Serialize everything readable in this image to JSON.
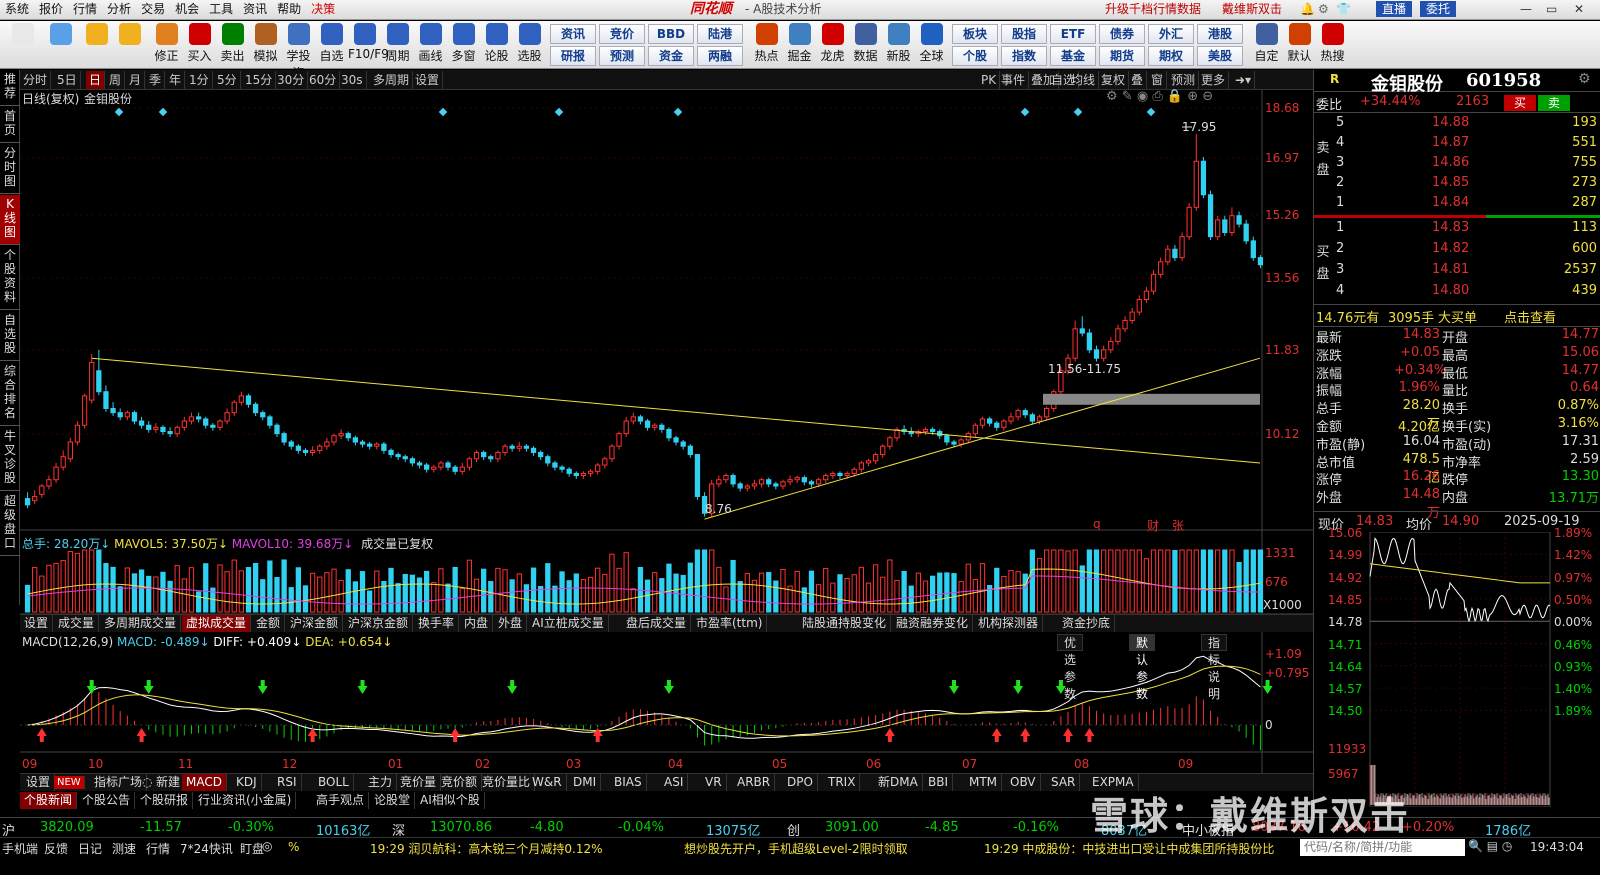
{
  "menu": {
    "items": [
      "系统",
      "报价",
      "行情",
      "分析",
      "交易",
      "机会",
      "工具",
      "资讯",
      "帮助",
      "决策"
    ],
    "logo": "同花顺",
    "title": "- A股技术分析",
    "promo": "升级千档行情数据",
    "user": "戴维斯双击",
    "live": "直播",
    "entrust": "委托"
  },
  "toolbar": {
    "icons": [
      {
        "label": "",
        "icon": "grid-icon",
        "color": "#e8e8e8"
      },
      {
        "label": "",
        "icon": "robot-icon",
        "color": "#5aa0e8"
      },
      {
        "label": "",
        "icon": "back-arrow-icon",
        "color": "#f0b020"
      },
      {
        "label": "",
        "icon": "updown-arrow-icon",
        "color": "#f0b020"
      },
      {
        "label": "修正",
        "icon": "fix-icon",
        "color": "#e08020"
      },
      {
        "label": "买入",
        "icon": "buy-icon",
        "color": "#d00000"
      },
      {
        "label": "卖出",
        "icon": "sell-icon",
        "color": "#008000"
      },
      {
        "label": "模拟",
        "icon": "hammer-icon",
        "color": "#b06020"
      },
      {
        "label": "学投资",
        "icon": "grad-cap-icon",
        "color": "#4070c0"
      },
      {
        "label": "自选",
        "icon": "star-icon",
        "color": "#3060c0"
      },
      {
        "label": "F10/F9",
        "icon": "f10-icon",
        "color": "#3060c0"
      },
      {
        "label": "周期",
        "icon": "clock-icon",
        "color": "#3060c0"
      },
      {
        "label": "画线",
        "icon": "pen-icon",
        "color": "#3060c0"
      },
      {
        "label": "多窗",
        "icon": "windows-icon",
        "color": "#3060c0"
      },
      {
        "label": "论股",
        "icon": "talk-icon",
        "color": "#3060c0"
      },
      {
        "label": "选股",
        "icon": "magnify-icon",
        "color": "#3060c0"
      }
    ],
    "btns1": [
      "资讯",
      "竞价",
      "BBD",
      "陆港"
    ],
    "btns2": [
      "研报",
      "预测",
      "资金",
      "两融"
    ],
    "icons2": [
      {
        "label": "热点",
        "icon": "fire-icon",
        "color": "#d04000"
      },
      {
        "label": "掘金",
        "icon": "gold-icon",
        "color": "#4080c0"
      },
      {
        "label": "龙虎",
        "icon": "dragon-icon",
        "color": "#d00000"
      },
      {
        "label": "数据",
        "icon": "pe-icon",
        "color": "#4060a0"
      },
      {
        "label": "新股",
        "icon": "ipo-icon",
        "color": "#4080c0"
      },
      {
        "label": "全球",
        "icon": "globe-icon",
        "color": "#2060c0"
      }
    ],
    "btns3": [
      "板块",
      "股指",
      "ETF",
      "债券",
      "外汇",
      "港股"
    ],
    "btns4": [
      "个股",
      "指数",
      "基金",
      "期货",
      "期权",
      "美股"
    ],
    "icons3": [
      {
        "label": "自定",
        "icon": "custom-icon",
        "color": "#4060a0"
      },
      {
        "label": "默认",
        "icon": "home-icon",
        "color": "#d04000"
      },
      {
        "label": "热搜",
        "icon": "hot-search-icon",
        "color": "#d00000"
      }
    ]
  },
  "leftnav": [
    "推荐",
    "首页",
    "分时图",
    "K线图",
    "个股资料",
    "自选股",
    "综合排名",
    "牛叉诊股",
    "超级盘口"
  ],
  "periods": [
    "分时",
    "5日",
    "日",
    "周",
    "月",
    "季",
    "年",
    "1分",
    "5分",
    "15分",
    "30分",
    "60分",
    "30s",
    "多周期",
    "设置"
  ],
  "period_right": [
    "PK",
    "事件",
    "叠加",
    "自选",
    "均线",
    "复权",
    "叠",
    "窗",
    "预测",
    "更多"
  ],
  "chart_head": {
    "mode": "日线(复权)",
    "name": "金钼股份"
  },
  "price_axis": [
    "18.68",
    "16.97",
    "15.26",
    "13.56",
    "11.83",
    "10.12"
  ],
  "annotations": {
    "high": "17.95",
    "low": "8.76",
    "gap": "11.56-11.75",
    "q": "q",
    "cai": "财",
    "zhang": "张"
  },
  "vol_head": {
    "total_label": "总手: ",
    "total": "28.20万",
    "mavol5_label": "MAVOL5: ",
    "mavol5": "37.50万",
    "mavol10_label": "MAVOL10: ",
    "mavol10": "39.68万",
    "note": "成交量已复权"
  },
  "vol_axis": [
    "1331",
    "676",
    "X1000"
  ],
  "ind_tabs": [
    "设置",
    "成交量",
    "多周期成交量",
    "虚拟成交量",
    "金额",
    "沪深金额",
    "沪深京金额",
    "换手率",
    "内盘",
    "外盘",
    "AI立桩成交量",
    "盘后成交量",
    "市盈率(ttm)",
    "陆股通持股变化",
    "融资融券变化",
    "机构探测器",
    "资金抄底"
  ],
  "macd_head": {
    "name": "MACD(12,26,9)",
    "macd_label": "MACD: ",
    "macd": "-0.489",
    "diff_label": "DIFF: ",
    "diff": "+0.409",
    "dea_label": "DEA: ",
    "dea": "+0.654"
  },
  "macd_buttons": [
    "优选参数",
    "默认参数",
    "指标说明"
  ],
  "macd_axis": [
    "+1.09",
    "+0.795",
    "0"
  ],
  "months": [
    "09",
    "10",
    "11",
    "12",
    "01",
    "02",
    "03",
    "04",
    "05",
    "06",
    "07",
    "08",
    "09"
  ],
  "bottom_tabs": [
    "设置",
    "NEW",
    "指标广场",
    "新建",
    "MACD",
    "KDJ",
    "RSI",
    "BOLL",
    "主力",
    "竞价量",
    "竞价额",
    "竞价量比",
    "W&R",
    "DMI",
    "BIAS",
    "ASI",
    "VR",
    "ARBR",
    "DPO",
    "TRIX",
    "新DMA",
    "BBI",
    "MTM",
    "OBV",
    "SAR",
    "EXPMA"
  ],
  "news_tabs": [
    "个股新闻",
    "个股公告",
    "个股研报",
    "行业资讯(小金属)",
    "高手观点",
    "论股堂",
    "AI相似个股"
  ],
  "stock": {
    "r": "R",
    "name": "金钼股份",
    "code": "601958",
    "weibi_label": "委比",
    "weibi": "+34.44%",
    "weicha": "2163",
    "buy": "买",
    "sell": "卖"
  },
  "asks": [
    {
      "lv": "5",
      "p": "14.88",
      "v": "193"
    },
    {
      "lv": "4",
      "p": "14.87",
      "v": "551"
    },
    {
      "lv": "3",
      "p": "14.86",
      "v": "755"
    },
    {
      "lv": "2",
      "p": "14.85",
      "v": "273"
    },
    {
      "lv": "1",
      "p": "14.84",
      "v": "287"
    }
  ],
  "bids": [
    {
      "lv": "1",
      "p": "14.83",
      "v": "113"
    },
    {
      "lv": "2",
      "p": "14.82",
      "v": "600"
    },
    {
      "lv": "3",
      "p": "14.81",
      "v": "2537"
    },
    {
      "lv": "4",
      "p": "14.80",
      "v": "439"
    }
  ],
  "side_labels": {
    "sell": "卖盘",
    "buy": "买盘"
  },
  "bigorder": {
    "price": "14.76元有",
    "hand": "3095手",
    "label": "大买单",
    "link": "点击查看"
  },
  "quote": [
    [
      "最新",
      "14.83",
      "开盘",
      "14.77"
    ],
    [
      "涨跌",
      "+0.05",
      "最高",
      "15.06"
    ],
    [
      "涨幅",
      "+0.34%",
      "最低",
      "14.77"
    ],
    [
      "振幅",
      "1.96%",
      "量比",
      "0.64"
    ],
    [
      "总手",
      "28.20万",
      "换手",
      "0.87%"
    ],
    [
      "金额",
      "4.20亿",
      "换手(实)",
      "3.16%"
    ],
    [
      "市盈(静)",
      "16.04",
      "市盈(动)",
      "17.31"
    ],
    [
      "总市值",
      "478.5亿",
      "市净率",
      "2.59"
    ],
    [
      "涨停",
      "16.26",
      "跌停",
      "13.30"
    ],
    [
      "外盘",
      "14.48万",
      "内盘",
      "13.71万"
    ]
  ],
  "intraday": {
    "now_label": "现价",
    "now": "14.83",
    "avg_label": "均价",
    "avg": "14.90",
    "date": "2025-09-19",
    "left_axis": [
      "15.06",
      "14.99",
      "14.92",
      "14.85",
      "14.78",
      "14.71",
      "14.64",
      "14.57",
      "14.50"
    ],
    "right_axis": [
      "1.89%",
      "1.42%",
      "0.97%",
      "0.50%",
      "0.00%",
      "0.46%",
      "0.93%",
      "1.40%",
      "1.89%"
    ],
    "vol_axis": [
      "11933",
      "5967"
    ]
  },
  "status": [
    {
      "name": "沪",
      "val": "3820.09",
      "chg": "-11.57",
      "pct": "-0.30%",
      "amt": "10163亿"
    },
    {
      "name": "深",
      "val": "13070.86",
      "chg": "-4.80",
      "pct": "-0.04%",
      "amt": "13075亿"
    },
    {
      "name": "创",
      "val": "3091.00",
      "chg": "-4.85",
      "pct": "-0.16%",
      "amt": "8037亿"
    }
  ],
  "status_extra": {
    "name": "中小板指",
    "val": "8037.16",
    "chg": "+16.42",
    "pct": "+0.20%",
    "amt": "1786亿"
  },
  "ticker": {
    "items": [
      "手机端",
      "反馈",
      "日记",
      "测速",
      "行情",
      "7*24快讯",
      "盯盘"
    ],
    "pct": "%",
    "news1": "19:29 润贝航科：高木锐三个月减持0.12%",
    "news2": "想炒股先开户，手机超级Level-2限时领取",
    "news3": "19:29 中成股份：中技进出口受让中成集团所持股份比",
    "search": "代码/名称/简拼/功能",
    "time": "19:43:04"
  },
  "watermark": "雪球：戴维斯双击",
  "chart_data": {
    "type": "candlestick",
    "ylim": [
      8.5,
      19.0
    ],
    "months": [
      "09",
      "10",
      "11",
      "12",
      "01",
      "02",
      "03",
      "04",
      "05",
      "06",
      "07",
      "08",
      "09"
    ],
    "candles": [
      [
        9.25,
        9.1,
        9.4
      ],
      [
        9.2,
        9.3,
        9.45
      ],
      [
        9.35,
        9.55,
        9.6
      ],
      [
        9.55,
        9.7,
        9.8
      ],
      [
        9.7,
        10.0,
        10.1
      ],
      [
        10.0,
        10.25,
        10.4
      ],
      [
        10.2,
        10.6,
        10.7
      ],
      [
        10.6,
        11.0,
        11.1
      ],
      [
        11.0,
        11.7,
        11.75
      ],
      [
        11.6,
        12.5,
        12.7
      ],
      [
        12.3,
        11.8,
        12.8
      ],
      [
        11.8,
        11.4,
        11.95
      ],
      [
        11.4,
        11.3,
        11.55
      ],
      [
        11.3,
        11.2,
        11.4
      ],
      [
        11.2,
        11.3,
        11.35
      ],
      [
        11.3,
        11.1,
        11.35
      ],
      [
        11.1,
        11.0,
        11.2
      ],
      [
        11.0,
        10.9,
        11.1
      ],
      [
        10.9,
        10.95,
        11.05
      ],
      [
        10.95,
        10.85,
        11.0
      ],
      [
        10.85,
        10.8,
        10.95
      ],
      [
        10.8,
        10.95,
        11.0
      ],
      [
        10.95,
        11.1,
        11.2
      ],
      [
        11.1,
        11.2,
        11.3
      ],
      [
        11.2,
        11.15,
        11.3
      ],
      [
        11.15,
        11.0,
        11.2
      ],
      [
        11.0,
        10.95,
        11.05
      ],
      [
        10.95,
        11.1,
        11.15
      ],
      [
        11.1,
        11.3,
        11.4
      ],
      [
        11.3,
        11.55,
        11.6
      ],
      [
        11.55,
        11.7,
        11.8
      ],
      [
        11.7,
        11.5,
        11.75
      ],
      [
        11.5,
        11.3,
        11.55
      ],
      [
        11.3,
        11.2,
        11.35
      ],
      [
        11.2,
        11.0,
        11.25
      ],
      [
        11.0,
        10.8,
        11.05
      ],
      [
        10.8,
        10.6,
        10.85
      ],
      [
        10.6,
        10.5,
        10.65
      ],
      [
        10.5,
        10.4,
        10.55
      ],
      [
        10.4,
        10.35,
        10.45
      ],
      [
        10.35,
        10.4,
        10.5
      ],
      [
        10.4,
        10.5,
        10.55
      ],
      [
        10.5,
        10.6,
        10.7
      ],
      [
        10.6,
        10.75,
        10.8
      ],
      [
        10.75,
        10.8,
        10.9
      ],
      [
        10.8,
        10.7,
        10.85
      ],
      [
        10.7,
        10.6,
        10.75
      ],
      [
        10.6,
        10.55,
        10.65
      ],
      [
        10.55,
        10.5,
        10.6
      ],
      [
        10.5,
        10.55,
        10.6
      ],
      [
        10.55,
        10.4,
        10.6
      ],
      [
        10.4,
        10.3,
        10.45
      ],
      [
        10.3,
        10.25,
        10.35
      ],
      [
        10.25,
        10.2,
        10.3
      ],
      [
        10.2,
        10.1,
        10.25
      ],
      [
        10.1,
        10.05,
        10.15
      ],
      [
        10.05,
        9.95,
        10.1
      ],
      [
        9.95,
        10.0,
        10.05
      ],
      [
        10.0,
        10.1,
        10.15
      ],
      [
        10.1,
        10.0,
        10.15
      ],
      [
        10.0,
        9.9,
        10.05
      ],
      [
        9.9,
        10.0,
        10.1
      ],
      [
        10.0,
        10.2,
        10.25
      ],
      [
        10.2,
        10.35,
        10.4
      ],
      [
        10.35,
        10.25,
        10.4
      ],
      [
        10.25,
        10.2,
        10.3
      ],
      [
        10.2,
        10.35,
        10.4
      ],
      [
        10.35,
        10.5,
        10.55
      ],
      [
        10.5,
        10.45,
        10.55
      ],
      [
        10.45,
        10.5,
        10.6
      ],
      [
        10.5,
        10.45,
        10.55
      ],
      [
        10.45,
        10.35,
        10.5
      ],
      [
        10.35,
        10.25,
        10.4
      ],
      [
        10.25,
        10.1,
        10.3
      ],
      [
        10.1,
        10.0,
        10.15
      ],
      [
        10.0,
        9.95,
        10.05
      ],
      [
        9.95,
        9.85,
        10.0
      ],
      [
        9.85,
        9.8,
        9.9
      ],
      [
        9.8,
        9.85,
        9.9
      ],
      [
        9.85,
        9.9,
        9.95
      ],
      [
        9.9,
        10.05,
        10.1
      ],
      [
        10.05,
        10.2,
        10.25
      ],
      [
        10.2,
        10.5,
        10.55
      ],
      [
        10.5,
        10.8,
        10.85
      ],
      [
        10.8,
        11.1,
        11.2
      ],
      [
        11.1,
        11.2,
        11.3
      ],
      [
        11.2,
        11.1,
        11.25
      ],
      [
        11.1,
        10.95,
        11.15
      ],
      [
        10.95,
        11.0,
        11.05
      ],
      [
        11.0,
        10.9,
        11.05
      ],
      [
        10.9,
        10.7,
        10.95
      ],
      [
        10.7,
        10.6,
        10.75
      ],
      [
        10.6,
        10.5,
        10.65
      ],
      [
        10.5,
        10.3,
        10.55
      ],
      [
        10.3,
        9.3,
        10.3
      ],
      [
        9.3,
        8.9,
        9.4
      ],
      [
        8.9,
        9.6,
        9.7
      ],
      [
        9.6,
        9.7,
        9.8
      ],
      [
        9.7,
        9.8,
        9.85
      ],
      [
        9.8,
        9.6,
        9.85
      ],
      [
        9.6,
        9.5,
        9.65
      ],
      [
        9.5,
        9.55,
        9.6
      ],
      [
        9.55,
        9.6,
        9.7
      ],
      [
        9.6,
        9.7,
        9.75
      ],
      [
        9.7,
        9.6,
        9.75
      ],
      [
        9.6,
        9.55,
        9.65
      ],
      [
        9.55,
        9.65,
        9.7
      ],
      [
        9.65,
        9.7,
        9.8
      ],
      [
        9.7,
        9.75,
        9.8
      ],
      [
        9.75,
        9.65,
        9.8
      ],
      [
        9.65,
        9.6,
        9.7
      ],
      [
        9.6,
        9.7,
        9.75
      ],
      [
        9.7,
        9.8,
        9.85
      ],
      [
        9.8,
        9.85,
        9.9
      ],
      [
        9.85,
        9.8,
        9.9
      ],
      [
        9.8,
        9.85,
        9.9
      ],
      [
        9.85,
        9.95,
        10.0
      ],
      [
        9.95,
        10.1,
        10.15
      ],
      [
        10.1,
        10.15,
        10.2
      ],
      [
        10.15,
        10.3,
        10.35
      ],
      [
        10.3,
        10.5,
        10.55
      ],
      [
        10.5,
        10.7,
        10.75
      ],
      [
        10.7,
        10.9,
        10.95
      ],
      [
        10.9,
        10.85,
        11.0
      ],
      [
        10.85,
        10.8,
        10.95
      ],
      [
        10.8,
        10.85,
        10.9
      ],
      [
        10.85,
        10.9,
        10.95
      ],
      [
        10.9,
        10.85,
        10.95
      ],
      [
        10.85,
        10.75,
        10.9
      ],
      [
        10.75,
        10.6,
        10.8
      ],
      [
        10.6,
        10.55,
        10.65
      ],
      [
        10.55,
        10.65,
        10.7
      ],
      [
        10.65,
        10.8,
        10.85
      ],
      [
        10.8,
        11.0,
        11.05
      ],
      [
        11.0,
        11.15,
        11.2
      ],
      [
        11.15,
        11.05,
        11.2
      ],
      [
        11.05,
        10.95,
        11.1
      ],
      [
        10.95,
        11.1,
        11.15
      ],
      [
        11.1,
        11.2,
        11.3
      ],
      [
        11.2,
        11.35,
        11.4
      ],
      [
        11.35,
        11.25,
        11.4
      ],
      [
        11.25,
        11.1,
        11.3
      ],
      [
        11.1,
        11.2,
        11.25
      ],
      [
        11.2,
        11.4,
        11.45
      ],
      [
        11.4,
        11.8,
        11.85
      ],
      [
        11.8,
        12.3,
        12.4
      ],
      [
        12.3,
        12.6,
        12.7
      ],
      [
        12.6,
        13.3,
        13.5
      ],
      [
        13.3,
        13.2,
        13.6
      ],
      [
        13.2,
        12.8,
        13.3
      ],
      [
        12.8,
        12.6,
        12.9
      ],
      [
        12.6,
        12.8,
        12.9
      ],
      [
        12.8,
        13.0,
        13.1
      ],
      [
        13.0,
        13.3,
        13.4
      ],
      [
        13.3,
        13.5,
        13.6
      ],
      [
        13.5,
        13.7,
        13.8
      ],
      [
        13.7,
        14.0,
        14.1
      ],
      [
        14.0,
        14.2,
        14.3
      ],
      [
        14.2,
        14.6,
        14.7
      ],
      [
        14.6,
        14.9,
        15.0
      ],
      [
        14.9,
        15.2,
        15.3
      ],
      [
        15.2,
        15.0,
        15.3
      ],
      [
        15.0,
        15.5,
        15.6
      ],
      [
        15.5,
        16.2,
        16.3
      ],
      [
        16.2,
        17.3,
        17.95
      ],
      [
        17.3,
        16.5,
        17.4
      ],
      [
        16.5,
        15.5,
        16.6
      ],
      [
        15.5,
        15.9,
        16.0
      ],
      [
        15.9,
        15.6,
        16.0
      ],
      [
        15.6,
        16.0,
        16.2
      ],
      [
        16.0,
        15.8,
        16.1
      ],
      [
        15.8,
        15.4,
        15.9
      ],
      [
        15.4,
        15.0,
        15.5
      ],
      [
        15.0,
        14.83,
        15.06
      ]
    ],
    "volumes": [],
    "trendlines": [
      {
        "from": [
          9,
          12.6
        ],
        "to": [
          181,
          10.1
        ]
      },
      {
        "from": [
          95,
          8.76
        ],
        "to": [
          181,
          12.6
        ]
      }
    ],
    "macd_signals": {
      "buy_arrows": [
        2,
        16,
        40,
        60,
        80,
        121,
        136,
        140,
        146,
        149
      ],
      "sell_arrows": [
        9,
        17,
        33,
        47,
        68,
        90,
        130,
        139,
        145,
        174
      ]
    }
  }
}
